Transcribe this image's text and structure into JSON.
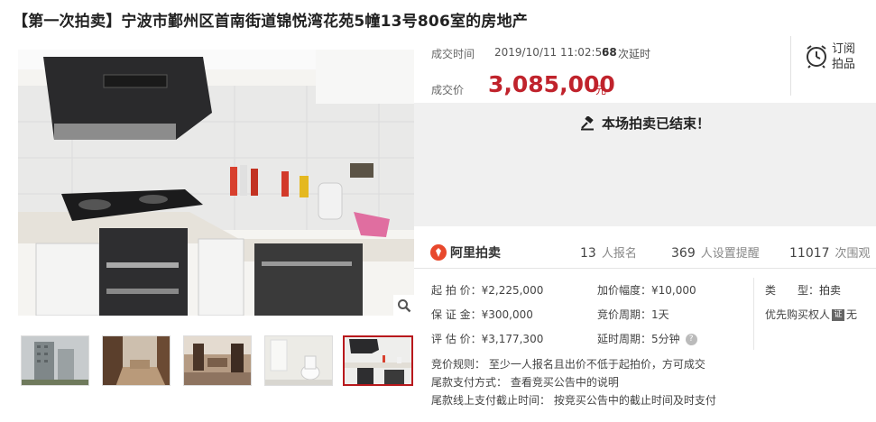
{
  "page": {
    "title": "【第一次拍卖】宁波市鄞州区首南街道锦悦湾花苑5幢13号806室的房地产"
  },
  "deal": {
    "time_label": "成交时间",
    "time_value": "2019/10/11 11:02:58",
    "delay_count": "68",
    "delay_label": "次延时",
    "price_label": "成交价",
    "price_value": "3,085,000",
    "price_unit": "元"
  },
  "subscribe": {
    "label_line1": "订阅",
    "label_line2": "拍品"
  },
  "status": {
    "ended_text": "本场拍卖已结束！"
  },
  "stats": {
    "brand": "阿里拍卖",
    "signup_count": "13",
    "signup_label": "人报名",
    "reminder_count": "369",
    "reminder_label": "人设置提醒",
    "view_count": "11017",
    "view_label": "次围观"
  },
  "details": {
    "start_price": "起 拍 价：¥2,225,000",
    "deposit": "保 证 金：¥300,000",
    "assess_price": "评 估 价：¥3,177,300",
    "increment": "加价幅度：¥10,000",
    "bid_period": "竞价周期：1天",
    "delay_period": "延时周期：5分钟",
    "type_label": "类　　型：",
    "type_value": "拍卖",
    "priority_label": "优先购买权人",
    "priority_value": "无",
    "cert_glyph": "证"
  },
  "rules": {
    "line1": "竞价规则：   至少一人报名且出价不低于起拍价，方可成交",
    "line2": "尾款支付方式：   查看竞买公告中的说明",
    "line3": "尾款线上支付截止时间：   按竞买公告中的截止时间及时支付"
  },
  "colors": {
    "price": "#c0232c",
    "active_thumb_border": "#b8181c",
    "ended_bg": "#f0f0f0",
    "brand": "#e8482c"
  },
  "icons": [
    "alarm-clock-icon",
    "gavel-icon",
    "zoom-icon",
    "help-icon",
    "certificate-icon",
    "ali-auction-logo-icon"
  ]
}
